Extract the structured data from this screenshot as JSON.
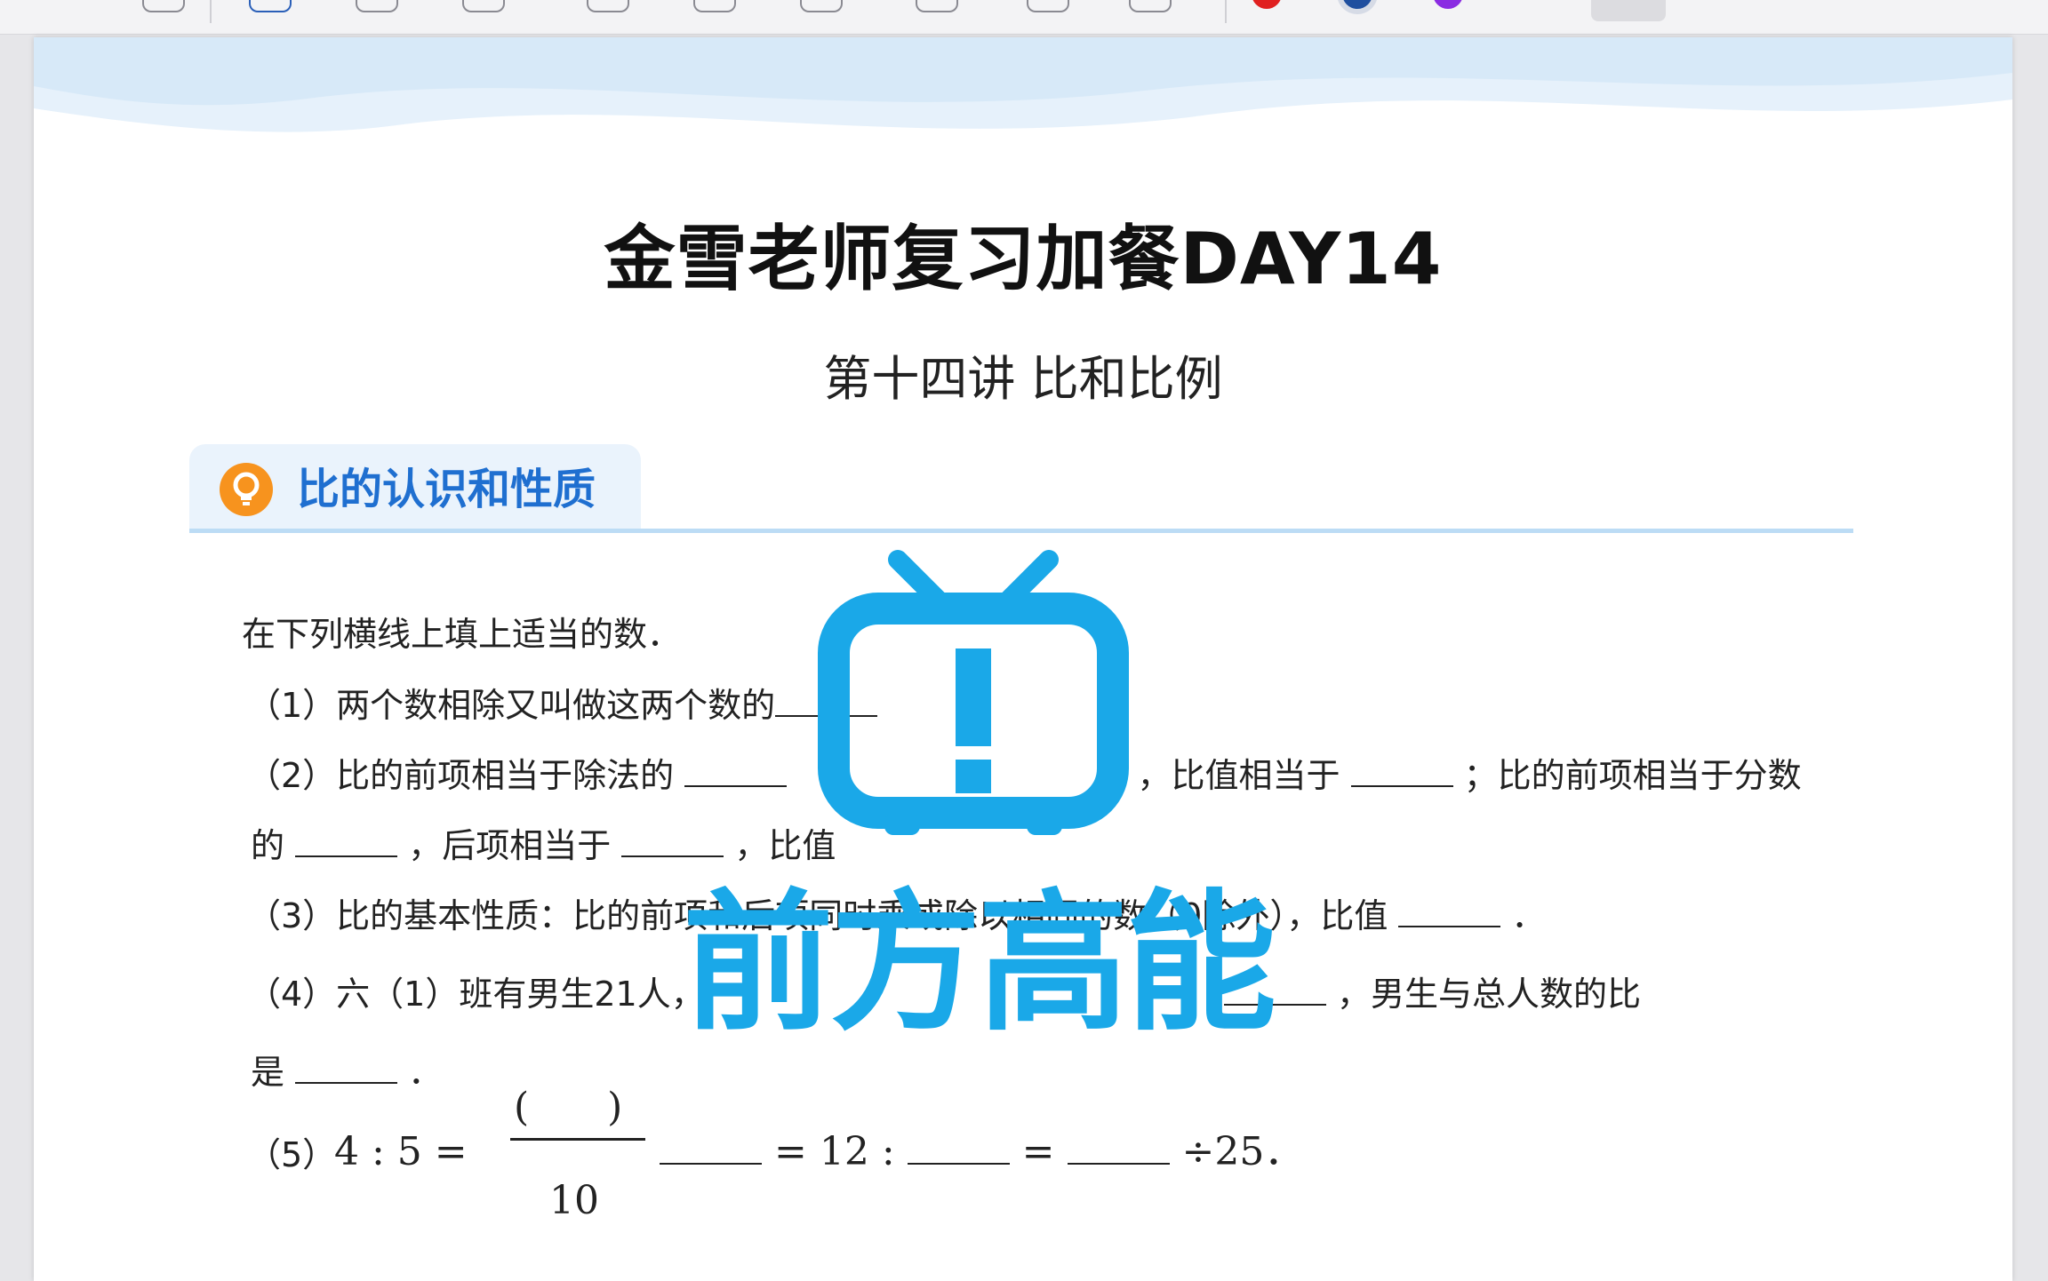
{
  "toolbar": {
    "icons": [
      "pen-icon",
      "highlighter-icon",
      "eraser-icon",
      "lasso-icon",
      "shape-icon",
      "laser-icon",
      "comment-icon",
      "textbox-icon",
      "table-icon",
      "attach-icon"
    ],
    "colors": [
      "#e02020",
      "#1f4f9f",
      "#8a2be2"
    ]
  },
  "document": {
    "title": "金雪老师复习加餐DAY14",
    "subtitle": "第十四讲 比和比例",
    "section": {
      "title": "比的认识和性质",
      "icon": "lightbulb-icon"
    },
    "intro": "在下列横线上填上适当的数．",
    "q1": "（1）两个数相除又叫做这两个数的",
    "q2a_1": "（2）比的前项相当于除法的",
    "q2a_2": "，比值相当于",
    "q2a_3": "；比的前项相当于分数",
    "q2b_1": "的",
    "q2b_2": "，后项相当于",
    "q2b_3": "，比值",
    "q3": "（3）比的基本性质：比的前项和后项同时乘或除以相同的数（0除外），比值",
    "q3_end": "．",
    "q4a_1": "（4）六（1）班有男生21人，",
    "q4a_2": "，男生与总人数的比",
    "q4b_1": "是",
    "q4b_2": "．",
    "q5_label": "（5）",
    "q5_math": "4 : 5 =",
    "q5_num": "(　　)",
    "q5_den": "10",
    "q5_eq1": "= 12 :",
    "q5_eq2": "=",
    "q5_eq3": "÷25．"
  },
  "overlay": {
    "text": "前方高能",
    "icon": "tv-exclamation-icon",
    "color": "#1aa8e8"
  }
}
